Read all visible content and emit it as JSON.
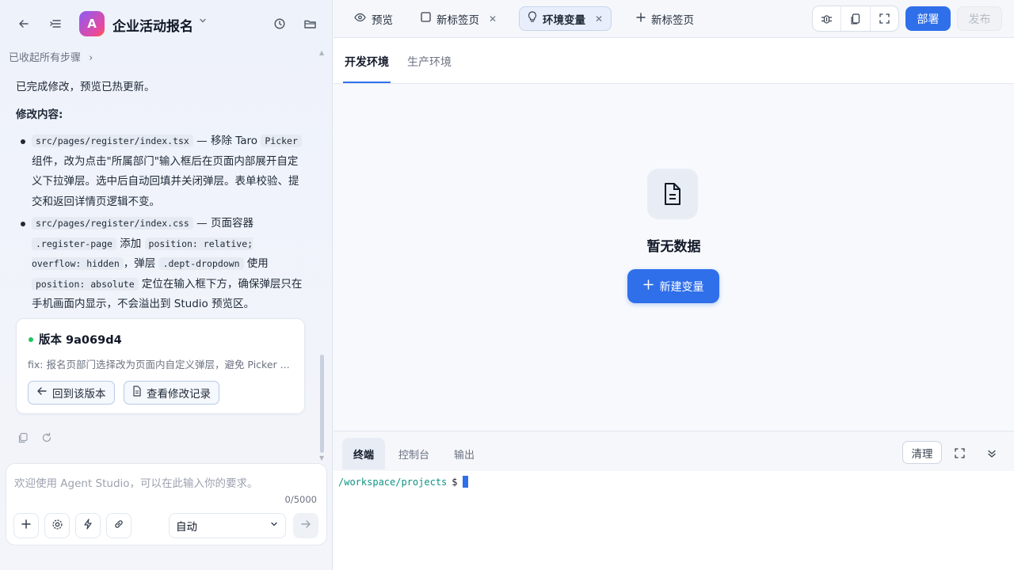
{
  "project": {
    "avatar_letter": "A",
    "title": "企业活动报名"
  },
  "chat": {
    "collapsed_label": "已收起所有步骤",
    "done_text": "已完成修改，预览已热更新。",
    "changes_heading": "修改内容:",
    "items": [
      {
        "file": "src/pages/register/index.tsx",
        "t1": " — 移除 Taro ",
        "code2": "Picker",
        "t2": " 组件，改为点击\"所属部门\"输入框后在页面内部展开自定义下拉弹层。选中后自动回填并关闭弹层。表单校验、提交和返回详情页逻辑不变。"
      },
      {
        "file": "src/pages/register/index.css",
        "t1": " — 页面容器 ",
        "code2": ".register-page",
        "t2": " 添加 ",
        "code3": "position: relative; overflow: hidden",
        "t3": "，弹层 ",
        "code4": ".dept-dropdown",
        "t4": " 使用 ",
        "code5": "position: absolute",
        "t5": " 定位在输入框下方，确保弹层只在手机画面内显示，不会溢出到 Studio 预览区。"
      }
    ],
    "version": {
      "title": "版本 9a069d4",
      "desc": "fix: 报名页部门选择改为页面内自定义弹层，避免 Picker ...",
      "revert_label": "回到该版本",
      "log_label": "查看修改记录",
      "status_color": "#22c55e"
    }
  },
  "composer": {
    "placeholder": "欢迎使用 Agent Studio，可以在此输入你的要求。",
    "counter": "0/5000",
    "mode": "自动"
  },
  "tabs": [
    {
      "label": "预览",
      "icon": "eye-icon"
    },
    {
      "label": "新标签页",
      "icon": "square-icon"
    },
    {
      "label": "环境变量",
      "icon": "lightbulb-icon",
      "active": true
    },
    {
      "label": "新标签页",
      "icon": "plus-icon"
    }
  ],
  "toolbar": {
    "deploy_label": "部署",
    "publish_label": "发布",
    "accent": "#2f6fea"
  },
  "env": {
    "tabs": [
      "开发环境",
      "生产环境"
    ],
    "empty_text": "暂无数据",
    "new_var_label": "新建变量"
  },
  "terminal": {
    "tabs": [
      "终端",
      "控制台",
      "输出"
    ],
    "clear_label": "清理",
    "prompt_path": "/workspace/projects",
    "prompt_symbol": "$"
  }
}
